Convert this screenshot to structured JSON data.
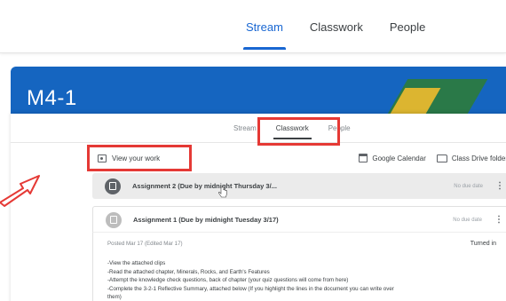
{
  "outer_tabs": {
    "stream": "Stream",
    "classwork": "Classwork",
    "people": "People"
  },
  "banner": {
    "title": "M4-1"
  },
  "inner_tabs": {
    "stream": "Stream",
    "classwork": "Classwork",
    "people": "People"
  },
  "toolbar": {
    "view_work": "View your work",
    "calendar": "Google Calendar",
    "drive": "Class Drive folder"
  },
  "assignments": [
    {
      "title": "Assignment 2 (Due by midnight Thursday 3/...",
      "due": "No due date"
    },
    {
      "title": "Assignment 1 (Due by midnight Tuesday 3/17)",
      "due": "No due date"
    }
  ],
  "detail": {
    "posted": "Posted Mar 17 (Edited Mar 17)",
    "status": "Turned in",
    "lines": [
      "-View the attached clips",
      "-Read the attached chapter, Minerals, Rocks, and Earth's Features",
      "-Attempt the knowledge check questions, back of chapter (your quiz questions will come from here)",
      "-Complete the 3-2-1 Reflective Summary, attached below (If you highlight the lines in the document you can write over",
      "them)"
    ]
  },
  "colors": {
    "accent_blue": "#1967d2",
    "banner": "#1565c0",
    "highlight_red": "#e53935"
  }
}
